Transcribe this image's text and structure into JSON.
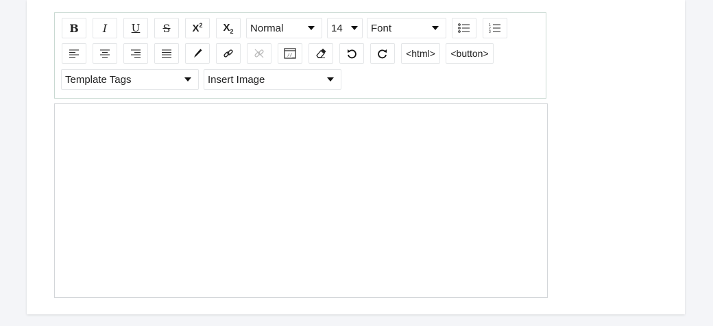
{
  "toolbar": {
    "format_block": "Normal",
    "font_size": "14",
    "font_family": "Font",
    "html_label": "<html>",
    "button_label": "<button>",
    "template_tags": "Template Tags",
    "insert_image": "Insert Image",
    "icons": [
      "bold-icon",
      "italic-icon",
      "underline-icon",
      "strikethrough-icon",
      "superscript-icon",
      "subscript-icon",
      "unordered-list-icon",
      "ordered-list-icon",
      "align-left-icon",
      "align-center-icon",
      "align-right-icon",
      "justify-icon",
      "text-color-icon",
      "link-icon",
      "unlink-icon",
      "code-view-icon",
      "eraser-icon",
      "undo-icon",
      "redo-icon"
    ]
  },
  "editor": {
    "content": ""
  }
}
